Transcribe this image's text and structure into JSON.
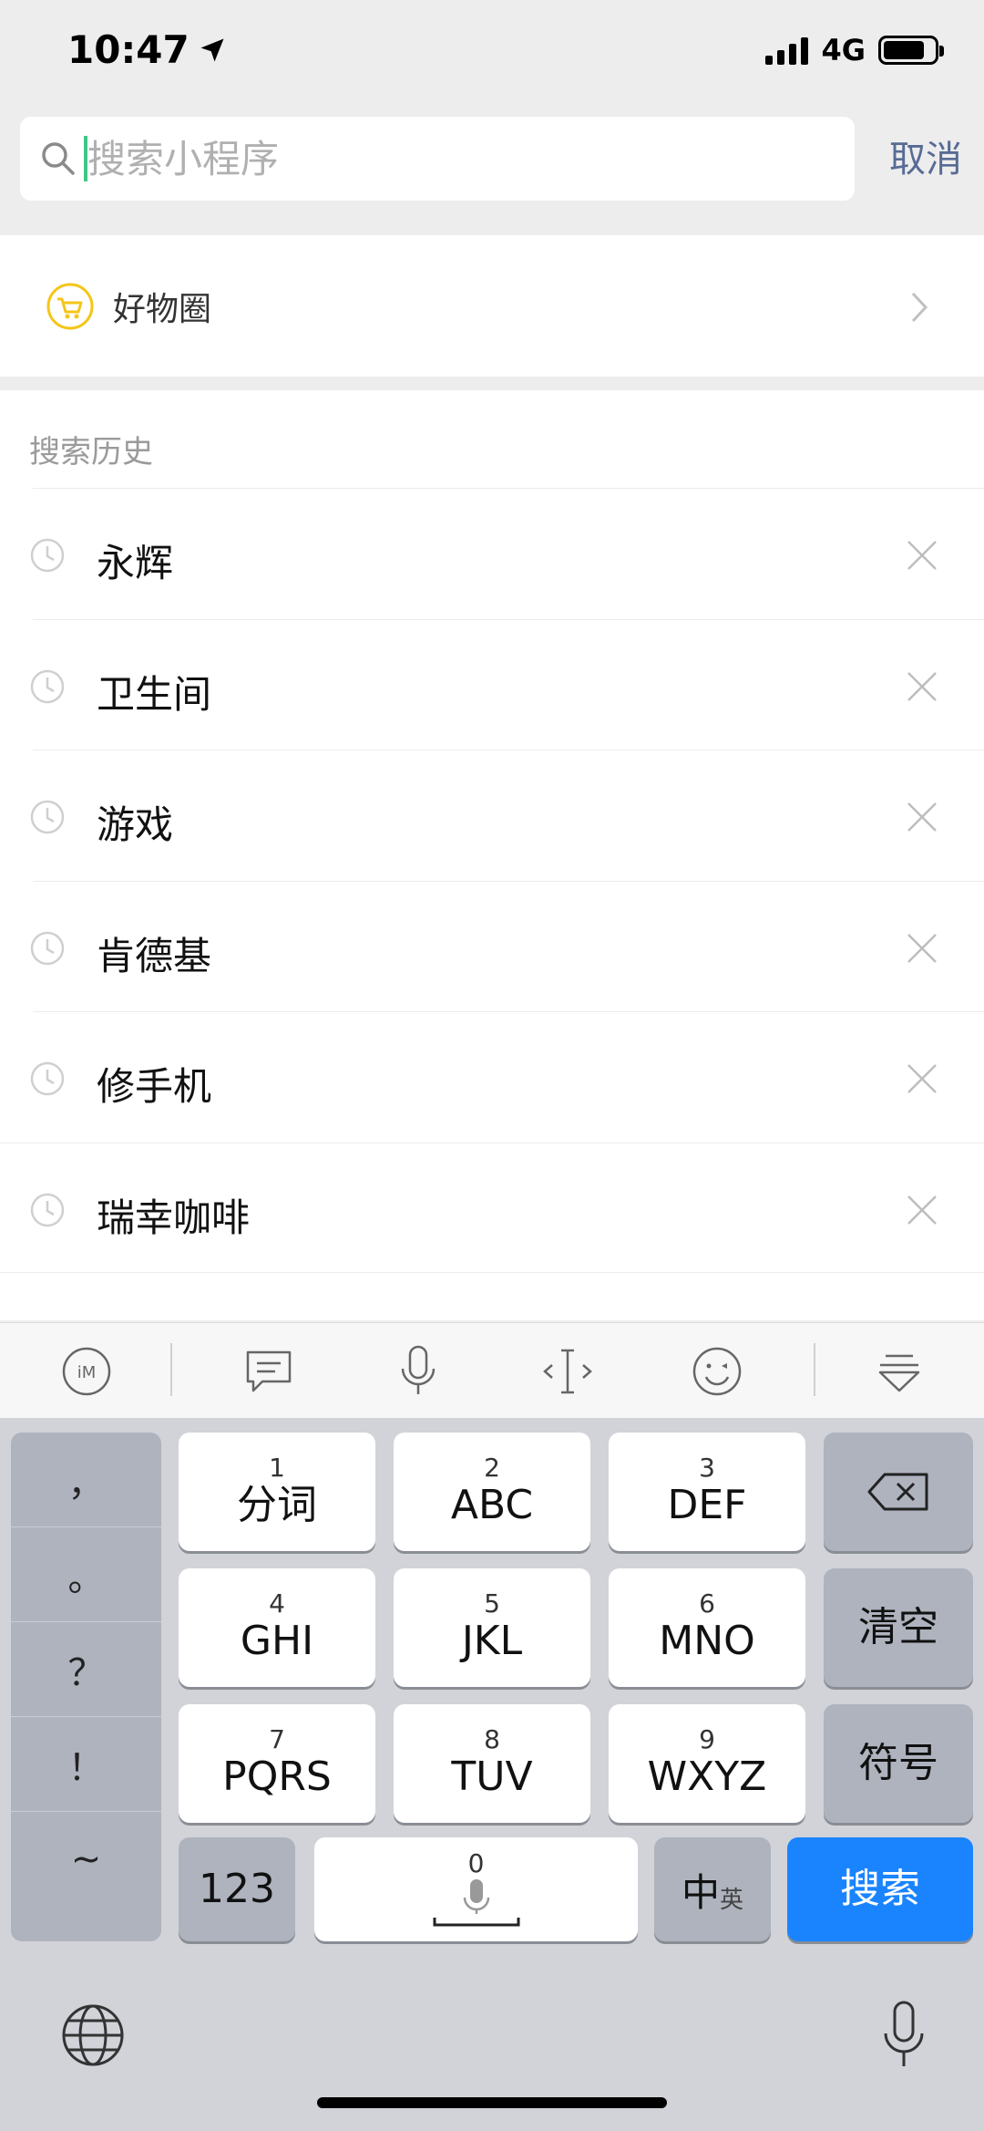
{
  "status_bar": {
    "time": "10:47",
    "network": "4G"
  },
  "search": {
    "placeholder": "搜索小程序",
    "cancel_label": "取消"
  },
  "featured": {
    "label": "好物圈"
  },
  "history": {
    "title": "搜索历史",
    "items": [
      "永辉",
      "卫生间",
      "游戏",
      "肯德基",
      "修手机",
      "瑞幸咖啡"
    ]
  },
  "keyboard": {
    "punctuation": [
      "，",
      "。",
      "？",
      "！",
      "~"
    ],
    "keys": {
      "k1": {
        "num": "1",
        "label": "分词"
      },
      "k2": {
        "num": "2",
        "label": "ABC"
      },
      "k3": {
        "num": "3",
        "label": "DEF"
      },
      "k4": {
        "num": "4",
        "label": "GHI"
      },
      "k5": {
        "num": "5",
        "label": "JKL"
      },
      "k6": {
        "num": "6",
        "label": "MNO"
      },
      "k7": {
        "num": "7",
        "label": "PQRS"
      },
      "k8": {
        "num": "8",
        "label": "TUV"
      },
      "k9": {
        "num": "9",
        "label": "WXYZ"
      },
      "k0": {
        "num": "0"
      }
    },
    "clear_label": "清空",
    "symbol_label": "符号",
    "numeric_label": "123",
    "lang_label_main": "中",
    "lang_label_sub": "英",
    "search_label": "搜索"
  },
  "colors": {
    "accent": "#576b95",
    "search_key": "#1a84ff",
    "caret": "#3ec787",
    "featured_icon": "#f5c518"
  }
}
